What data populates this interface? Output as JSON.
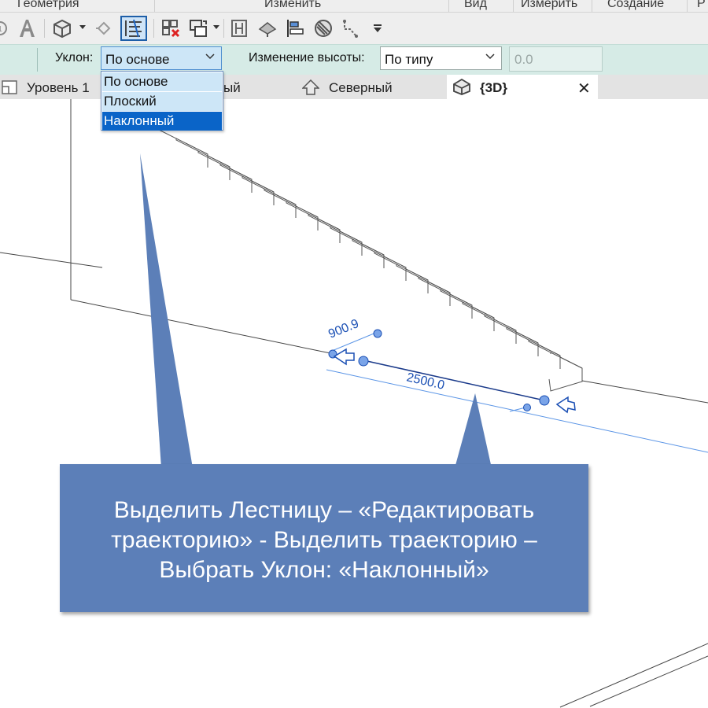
{
  "ribbon": {
    "panels": [
      "Геометрия",
      "Изменить",
      "Вид",
      "Измерить",
      "Создание",
      "Р"
    ]
  },
  "toolbar": {
    "icons": [
      "measure-icon",
      "text-icon",
      "3d-box-icon",
      "dropdown-arrow",
      "point-icon",
      "stair-path-icon",
      "delete-cross-icon",
      "copy-icon",
      "dropdown-arrow",
      "split-icon",
      "paint-icon",
      "align-icon",
      "hatch-icon",
      "path-icon",
      "overflow-arrow"
    ]
  },
  "options_bar": {
    "slope_label": "Уклон:",
    "slope_value": "По основе",
    "height_label": "Изменение высоты:",
    "height_value": "По типу",
    "offset_value": "0.0"
  },
  "dropdown": {
    "options": [
      "По основе",
      "Плоский",
      "Наклонный"
    ],
    "selected_index": 2
  },
  "tabs": [
    {
      "label": "Уровень 1",
      "icon": "floor-plan-icon",
      "active": false
    },
    {
      "label": "ый",
      "icon": "",
      "active": false
    },
    {
      "label": "Северный",
      "icon": "elevation-icon",
      "active": false
    },
    {
      "label": "{3D}",
      "icon": "3d-house-icon",
      "active": true
    }
  ],
  "close_symbol": "✕",
  "viewport": {
    "dimension_width": "900.9",
    "dimension_length": "2500.0"
  },
  "callout": {
    "text": "Выделить Лестницу – «Редактировать траекторию» - Выделить траекторию – Выбрать Уклон: «Наклонный»"
  },
  "colors": {
    "selection": "#0a64c8",
    "callout": "#5c7fb8",
    "dimension": "#1a4fb4",
    "options_bar": "#d6ebe6"
  }
}
